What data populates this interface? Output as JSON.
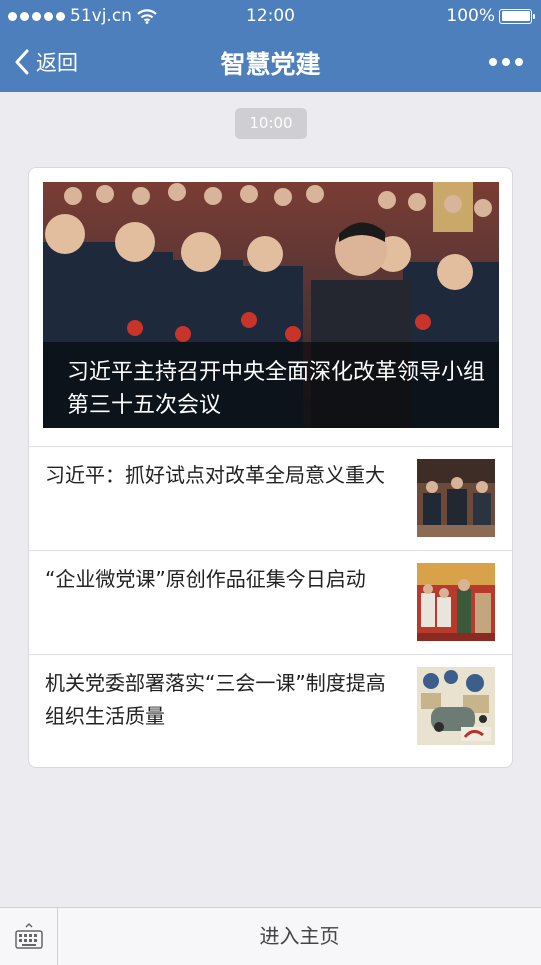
{
  "status_bar": {
    "carrier": "51vj.cn",
    "time": "12:00",
    "battery": "100%",
    "battery_level": 1.0
  },
  "nav": {
    "back_label": "返回",
    "title": "智慧党建",
    "more_icon": "ellipsis-icon"
  },
  "timestamp": "10:00",
  "article_card": {
    "cover": {
      "title": "习近平主持召开中央全面深化改革领导小组第三十五次会议"
    },
    "items": [
      {
        "title": "习近平：抓好试点对改革全局意义重大"
      },
      {
        "title": "“企业微党课”原创作品征集今日启动"
      },
      {
        "title": "机关党委部署落实“三会一课”制度提高组织生活质量"
      }
    ]
  },
  "bottom_bar": {
    "keyboard_icon": "keyboard-icon",
    "menu_label": "进入主页"
  },
  "colors": {
    "nav_background": "#4d7fbd",
    "page_background": "#ebebf0",
    "timestamp_badge": "#cfcfd3"
  }
}
